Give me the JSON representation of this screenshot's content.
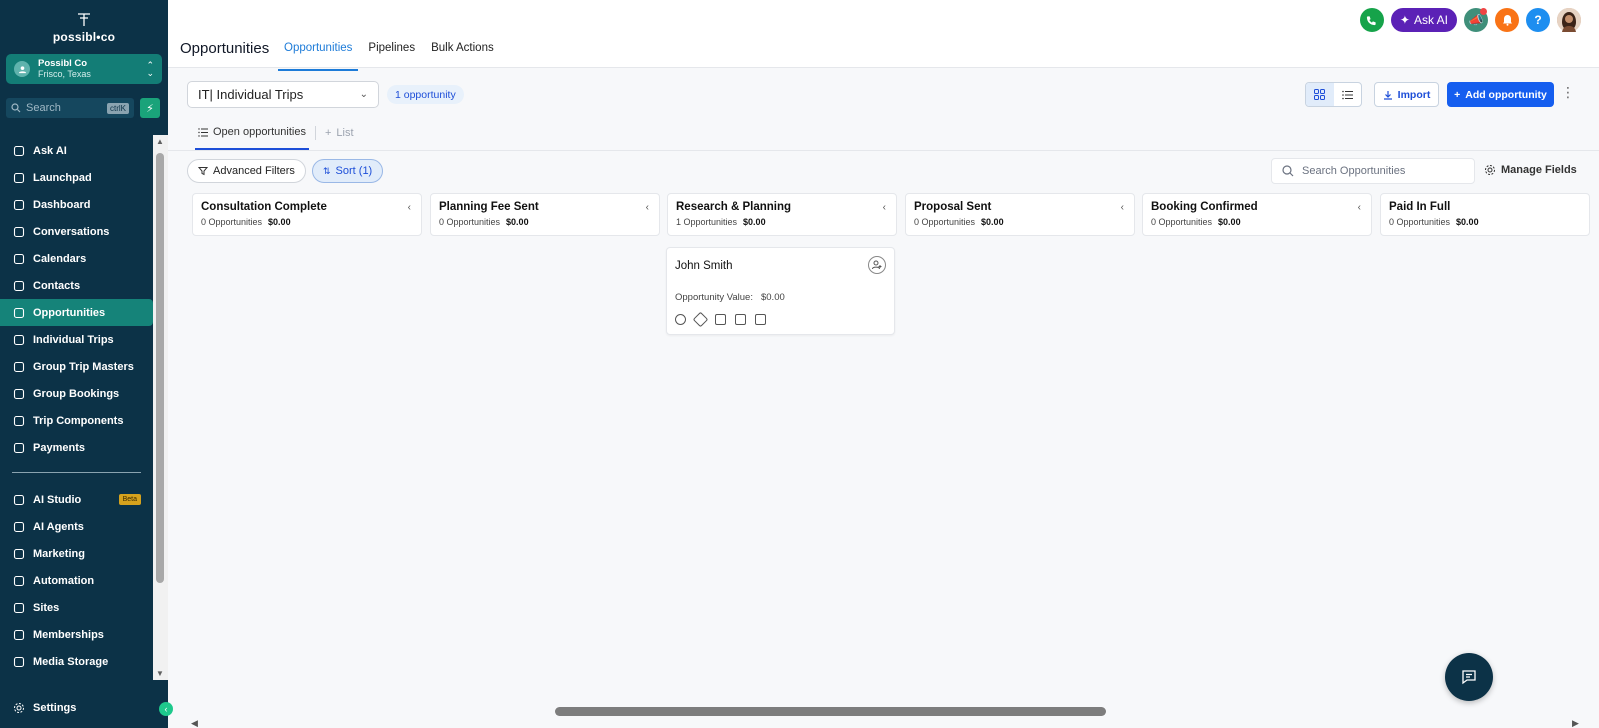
{
  "brand": {
    "logo_text": "possibl•co"
  },
  "location": {
    "name": "Possibl Co",
    "city": "Frisco, Texas"
  },
  "sidebar_search": {
    "placeholder": "Search",
    "shortcut": "ctrlK"
  },
  "sidebar": {
    "items": [
      {
        "label": "Ask AI",
        "icon": "sparkle-icon"
      },
      {
        "label": "Launchpad",
        "icon": "rocket-icon"
      },
      {
        "label": "Dashboard",
        "icon": "dashboard-icon"
      },
      {
        "label": "Conversations",
        "icon": "chat-icon"
      },
      {
        "label": "Calendars",
        "icon": "calendar-icon"
      },
      {
        "label": "Contacts",
        "icon": "contacts-icon"
      },
      {
        "label": "Opportunities",
        "icon": "opportunities-icon",
        "active": true
      },
      {
        "label": "Individual Trips",
        "icon": "plane-icon"
      },
      {
        "label": "Group Trip Masters",
        "icon": "group-icon"
      },
      {
        "label": "Group Bookings",
        "icon": "booking-icon"
      },
      {
        "label": "Trip Components",
        "icon": "components-icon"
      },
      {
        "label": "Payments",
        "icon": "payments-icon"
      }
    ],
    "items2": [
      {
        "label": "AI Studio",
        "icon": "ai-studio-icon",
        "badge": "Beta"
      },
      {
        "label": "AI Agents",
        "icon": "ai-agents-icon"
      },
      {
        "label": "Marketing",
        "icon": "send-icon"
      },
      {
        "label": "Automation",
        "icon": "automation-icon"
      },
      {
        "label": "Sites",
        "icon": "sites-icon"
      },
      {
        "label": "Memberships",
        "icon": "membership-icon"
      },
      {
        "label": "Media Storage",
        "icon": "media-icon"
      }
    ],
    "settings": "Settings"
  },
  "header": {
    "title": "Opportunities",
    "tabs": [
      "Opportunities",
      "Pipelines",
      "Bulk Actions"
    ],
    "ask_ai": "Ask AI",
    "help": "?"
  },
  "toolbar": {
    "pipeline": "IT| Individual Trips",
    "count": "1 opportunity",
    "import": "Import",
    "add": "Add opportunity"
  },
  "subtabs": {
    "open": "Open opportunities",
    "list": "List"
  },
  "filters": {
    "advanced": "Advanced Filters",
    "sort": "Sort (1)",
    "search_placeholder": "Search Opportunities",
    "manage": "Manage Fields"
  },
  "columns": [
    {
      "name": "Consultation Complete",
      "count": "0 Opportunities",
      "value": "$0.00"
    },
    {
      "name": "Planning Fee Sent",
      "count": "0 Opportunities",
      "value": "$0.00"
    },
    {
      "name": "Research & Planning",
      "count": "1 Opportunities",
      "value": "$0.00"
    },
    {
      "name": "Proposal Sent",
      "count": "0 Opportunities",
      "value": "$0.00"
    },
    {
      "name": "Booking Confirmed",
      "count": "0 Opportunities",
      "value": "$0.00"
    },
    {
      "name": "Paid In Full",
      "count": "0 Opportunities",
      "value": "$0.00"
    }
  ],
  "card": {
    "name": "John Smith",
    "value_label": "Opportunity Value:",
    "value": "$0.00"
  },
  "colors": {
    "sidebar": "#0c3247",
    "active": "#158379",
    "primary": "#155eef"
  }
}
